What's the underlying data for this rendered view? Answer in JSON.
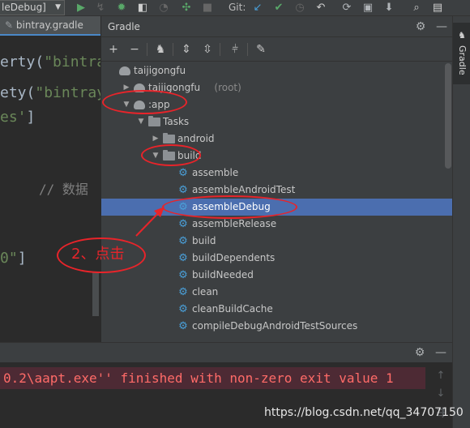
{
  "toolbar": {
    "run_config": "leDebug]",
    "git_label": "Git:",
    "icons": [
      "run-icon",
      "attach-debugger-icon",
      "debug-icon",
      "coverage-icon",
      "profile-icon",
      "build-variants-icon",
      "stop-icon",
      "git-update-icon",
      "git-commit-icon",
      "history-icon",
      "rollback-icon",
      "sync-gradle-icon",
      "avd-manager-icon",
      "sdk-manager-icon",
      "search-icon",
      "project-structure-icon"
    ]
  },
  "editor": {
    "tab_label": "bintray.gradle",
    "code_lines": [
      {
        "pre": "erty(",
        "str": "\"bintra"
      },
      {
        "pre": "ety(",
        "str": "\"bintray"
      },
      {
        "pre": "",
        "str": "es'",
        "post": "]"
      },
      {
        "comment": "// 数据"
      },
      {
        "pre": "",
        "str": "0\"",
        "post": "]"
      }
    ]
  },
  "gradle": {
    "title": "Gradle",
    "header_icons": [
      "gear-icon",
      "hide-icon"
    ],
    "tool_icons": [
      "add-icon",
      "remove-icon",
      "execute-task-icon",
      "expand-all-icon",
      "collapse-all-icon",
      "toggle-offline-icon",
      "settings-wrench-icon"
    ],
    "tree": [
      {
        "label": "taijigongfu",
        "suffix": "",
        "indent": 0,
        "icon": "gradle-elephant-icon",
        "twist": ""
      },
      {
        "label": "taijigongfu",
        "suffix": " (root)",
        "indent": 1,
        "icon": "gradle-elephant-icon",
        "twist": "collapsed"
      },
      {
        "label": ":app",
        "suffix": "",
        "indent": 1,
        "icon": "gradle-elephant-icon",
        "twist": "expanded"
      },
      {
        "label": "Tasks",
        "suffix": "",
        "indent": 2,
        "icon": "folder-icon",
        "twist": "expanded"
      },
      {
        "label": "android",
        "suffix": "",
        "indent": 3,
        "icon": "folder-icon",
        "twist": "collapsed"
      },
      {
        "label": "build",
        "suffix": "",
        "indent": 3,
        "icon": "folder-icon",
        "twist": "expanded"
      },
      {
        "label": "assemble",
        "suffix": "",
        "indent": 4,
        "icon": "task-gear-icon",
        "twist": ""
      },
      {
        "label": "assembleAndroidTest",
        "suffix": "",
        "indent": 4,
        "icon": "task-gear-icon",
        "twist": ""
      },
      {
        "label": "assembleDebug",
        "suffix": "",
        "indent": 4,
        "icon": "task-gear-icon",
        "twist": "",
        "selected": true
      },
      {
        "label": "assembleRelease",
        "suffix": "",
        "indent": 4,
        "icon": "task-gear-icon",
        "twist": ""
      },
      {
        "label": "build",
        "suffix": "",
        "indent": 4,
        "icon": "task-gear-icon",
        "twist": ""
      },
      {
        "label": "buildDependents",
        "suffix": "",
        "indent": 4,
        "icon": "task-gear-icon",
        "twist": ""
      },
      {
        "label": "buildNeeded",
        "suffix": "",
        "indent": 4,
        "icon": "task-gear-icon",
        "twist": ""
      },
      {
        "label": "clean",
        "suffix": "",
        "indent": 4,
        "icon": "task-gear-icon",
        "twist": ""
      },
      {
        "label": "cleanBuildCache",
        "suffix": "",
        "indent": 4,
        "icon": "task-gear-icon",
        "twist": ""
      },
      {
        "label": "compileDebugAndroidTestSources",
        "suffix": "",
        "indent": 4,
        "icon": "task-gear-icon",
        "twist": ""
      }
    ]
  },
  "right_stripe": {
    "label": "Gradle"
  },
  "build_output": {
    "error_text": "0.2\\aapt.exe'' finished with non-zero exit value 1"
  },
  "annotation": {
    "label": "2、点击",
    "color": "#e8242a"
  },
  "watermark": "https://blog.csdn.net/qq_34707150"
}
